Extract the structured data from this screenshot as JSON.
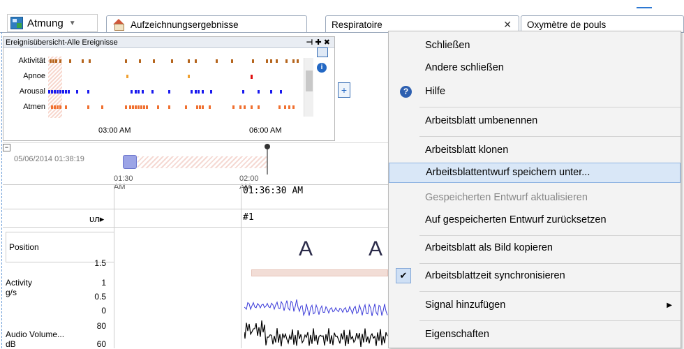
{
  "header": {
    "workspace_label": "Atmung",
    "tabs": [
      {
        "label": "Aufzeichnungsergebnisse"
      },
      {
        "label": "Respiratoire",
        "close": "✕"
      },
      {
        "label": "Oxymètre de pouls"
      }
    ]
  },
  "event_overview": {
    "title": "Ereignisübersicht-Alle Ereignisse",
    "title_buttons": "⊣ ✚ ✖",
    "rows": [
      "Aktivität",
      "Apnoe",
      "Arousal",
      "Atmen"
    ],
    "time_labels": [
      "03:00 AM",
      "06:00 AM"
    ],
    "colors": {
      "activity": "#b5651d",
      "apnoe": "#f0a030",
      "arousal": "#1a1aef",
      "atmen": "#f07030",
      "red": "#e01010"
    }
  },
  "timeline": {
    "date": "05/06/2014 01:38:19",
    "ticks": [
      "01:30 AM",
      "02:00 AM"
    ],
    "collapse": "⊟"
  },
  "grid": {
    "current_time": "01:36:30 AM",
    "epoch": "#1",
    "signal_icon": "ᴜᴫ▸",
    "event_letters": [
      "A",
      "A"
    ],
    "channels": [
      {
        "name": "Position"
      },
      {
        "name": "Activity",
        "unit": "g/s",
        "scale": [
          "1.5",
          "1",
          "0.5",
          "0"
        ]
      },
      {
        "name": "Audio Volume...",
        "unit": "dB",
        "scale": [
          "80",
          "60"
        ]
      }
    ]
  },
  "context_menu": {
    "items": [
      {
        "label": "Schließen"
      },
      {
        "label": "Andere schließen"
      },
      {
        "label": "Hilfe",
        "icon": "?"
      },
      {
        "label": "Arbeitsblatt umbenennen"
      },
      {
        "label": "Arbeitsblatt klonen"
      },
      {
        "label": "Arbeitsblattentwurf speichern unter..."
      },
      {
        "label": "Gespeicherten Entwurf aktualisieren"
      },
      {
        "label": "Auf gespeicherten Entwurf zurücksetzen"
      },
      {
        "label": "Arbeitsblatt als Bild kopieren"
      },
      {
        "label": "Arbeitsblattzeit synchronisieren",
        "check": "✔"
      },
      {
        "label": "Signal hinzufügen",
        "arrow": "▶"
      },
      {
        "label": "Eigenschaften"
      }
    ]
  }
}
